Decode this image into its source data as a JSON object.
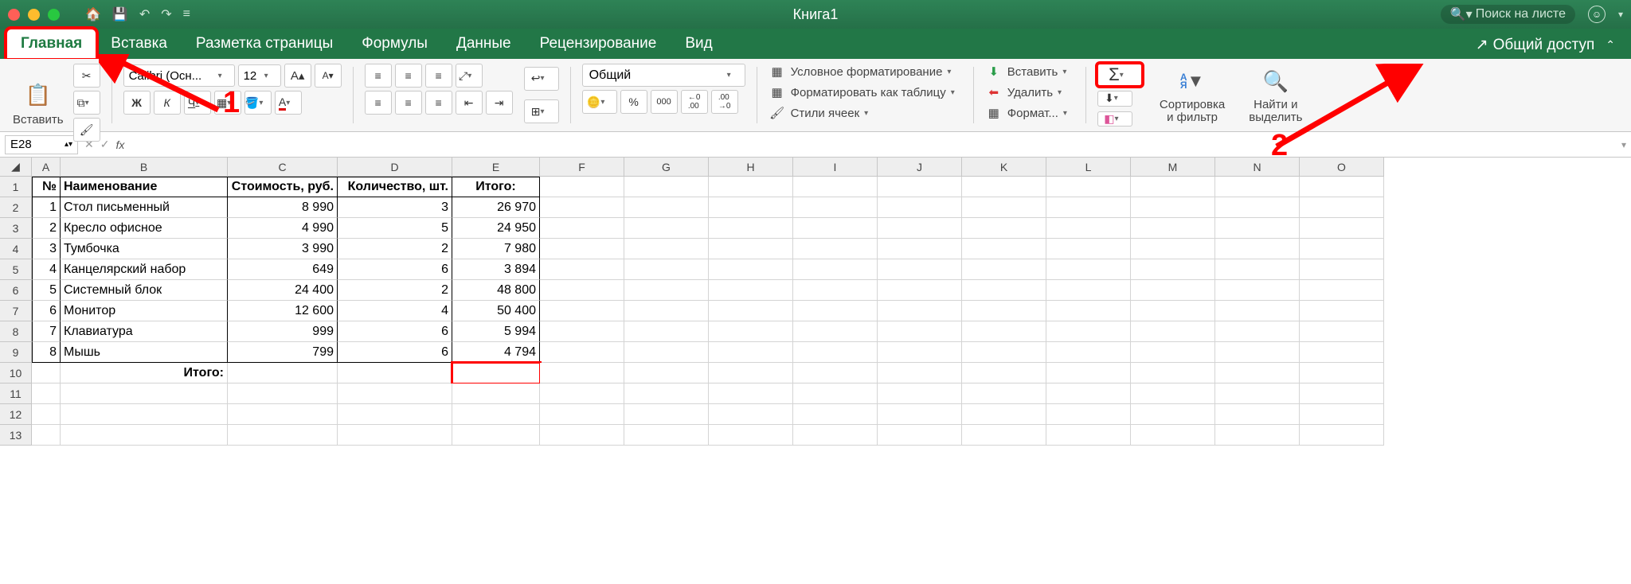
{
  "titlebar": {
    "document_title": "Книга1",
    "search_placeholder": "Поиск на листе"
  },
  "tabs": {
    "items": [
      "Главная",
      "Вставка",
      "Разметка страницы",
      "Формулы",
      "Данные",
      "Рецензирование",
      "Вид"
    ],
    "share": "Общий доступ"
  },
  "ribbon": {
    "paste": "Вставить",
    "font_name": "Calibri (Осн...",
    "font_size": "12",
    "number_format": "Общий",
    "cond_fmt": "Условное форматирование",
    "as_table": "Форматировать как таблицу",
    "cell_styles": "Стили ячеек",
    "insert": "Вставить",
    "delete": "Удалить",
    "format": "Формат...",
    "sort_filter": "Сортировка\nи фильтр",
    "find_select": "Найти и\nвыделить"
  },
  "formula_bar": {
    "cell_ref": "E28"
  },
  "columns": [
    "A",
    "B",
    "C",
    "D",
    "E",
    "F",
    "G",
    "H",
    "I",
    "J",
    "K",
    "L",
    "M",
    "N",
    "O"
  ],
  "sheet": {
    "headers": {
      "A": "№",
      "B": "Наименование",
      "C": "Стоимость, руб.",
      "D": "Количество, шт.",
      "E": "Итого:"
    },
    "rows": [
      {
        "n": 1,
        "name": "Стол письменный",
        "cost": "8 990",
        "qty": 3,
        "total": "26 970"
      },
      {
        "n": 2,
        "name": "Кресло офисное",
        "cost": "4 990",
        "qty": 5,
        "total": "24 950"
      },
      {
        "n": 3,
        "name": "Тумбочка",
        "cost": "3 990",
        "qty": 2,
        "total": "7 980"
      },
      {
        "n": 4,
        "name": "Канцелярский набор",
        "cost": "649",
        "qty": 6,
        "total": "3 894"
      },
      {
        "n": 5,
        "name": "Системный блок",
        "cost": "24 400",
        "qty": 2,
        "total": "48 800"
      },
      {
        "n": 6,
        "name": "Монитор",
        "cost": "12 600",
        "qty": 4,
        "total": "50 400"
      },
      {
        "n": 7,
        "name": "Клавиатура",
        "cost": "999",
        "qty": 6,
        "total": "5 994"
      },
      {
        "n": 8,
        "name": "Мышь",
        "cost": "799",
        "qty": 6,
        "total": "4 794"
      }
    ],
    "footer_label": "Итого:"
  },
  "annotations": {
    "one": "1",
    "two": "2"
  }
}
